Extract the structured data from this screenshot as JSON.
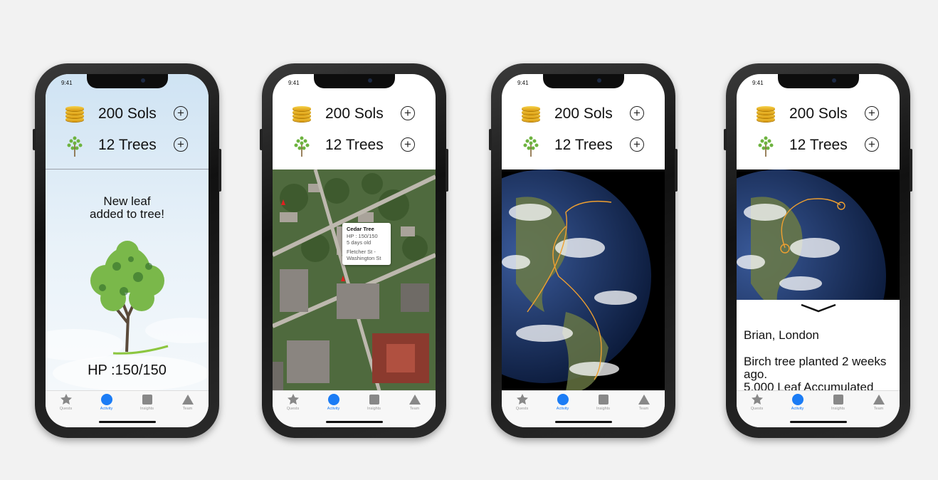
{
  "status_time": "9:41",
  "header": {
    "sols_label": "200 Sols",
    "trees_label": "12 Trees",
    "plus_glyph": "+"
  },
  "tabs": [
    {
      "label": "Quests",
      "icon": "star-icon",
      "active": false
    },
    {
      "label": "Activity",
      "icon": "circle-icon",
      "active": true
    },
    {
      "label": "Insights",
      "icon": "square-icon",
      "active": false
    },
    {
      "label": "Team",
      "icon": "triangle-icon",
      "active": false
    }
  ],
  "screen1": {
    "message": "New leaf\nadded to tree!",
    "hp": "HP :150/150"
  },
  "screen2": {
    "popup": {
      "title": "Cedar Tree",
      "hp": "HP : 150/150",
      "age": "5 days old",
      "location_line1": "Fletcher St -",
      "location_line2": "Washington St"
    }
  },
  "screen4": {
    "name": "Brian, London",
    "message": "Birch tree planted 2 weeks ago.",
    "message2": "5,000 Leaf Accumulated"
  },
  "colors": {
    "accent": "#1b7cf5",
    "arc": "#f0a030",
    "coin": "#e8b421",
    "tree_green": "#6db33f"
  }
}
